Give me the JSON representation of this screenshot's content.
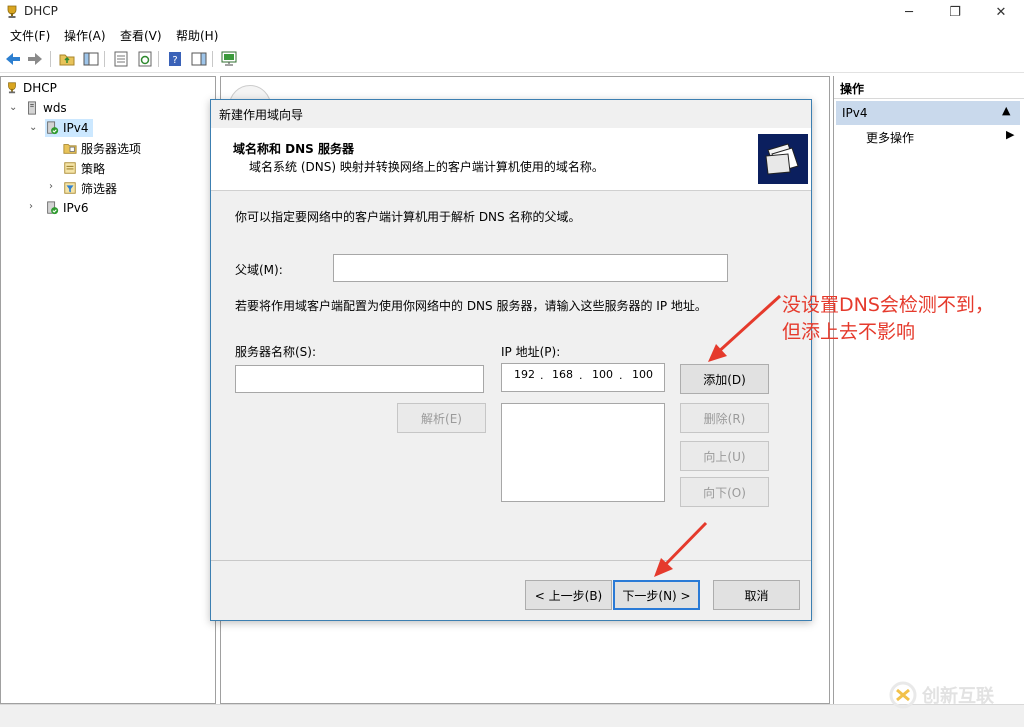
{
  "window": {
    "title": "DHCP"
  },
  "menu": [
    "文件(F)",
    "操作(A)",
    "查看(V)",
    "帮助(H)"
  ],
  "tree": {
    "root": "DHCP",
    "server": "wds",
    "ipv4": "IPv4",
    "server_options": "服务器选项",
    "policies": "策略",
    "filters": "筛选器",
    "ipv6": "IPv6"
  },
  "actions": {
    "header": "操作",
    "section": "IPv4",
    "more": "更多操作"
  },
  "dialog": {
    "title": "新建作用域向导",
    "heading": "域名称和 DNS 服务器",
    "subheading": "域名系统 (DNS) 映射并转换网络上的客户端计算机使用的域名称。",
    "intro": "你可以指定要网络中的客户端计算机用于解析 DNS 名称的父域。",
    "parent_domain_label": "父域(M):",
    "parent_domain_value": "",
    "dns_instruction": "若要将作用域客户端配置为使用你网络中的 DNS 服务器，请输入这些服务器的 IP 地址。",
    "server_name_label": "服务器名称(S):",
    "server_name_value": "",
    "ip_label": "IP 地址(P):",
    "ip_octets": [
      "192",
      "168",
      "100",
      "100"
    ],
    "ip_dot": ".",
    "buttons": {
      "resolve": "解析(E)",
      "add": "添加(D)",
      "remove": "删除(R)",
      "up": "向上(U)",
      "down": "向下(O)",
      "back": "< 上一步(B)",
      "next": "下一步(N) >",
      "cancel": "取消"
    }
  },
  "annotation": {
    "line1": "没设置DNS会检测不到，",
    "line2": "但添上去不影响"
  },
  "watermark": "创新互联",
  "colors": {
    "accent": "#2a7ad6",
    "annotation": "#e53a2c",
    "selection": "#cce8ff"
  }
}
